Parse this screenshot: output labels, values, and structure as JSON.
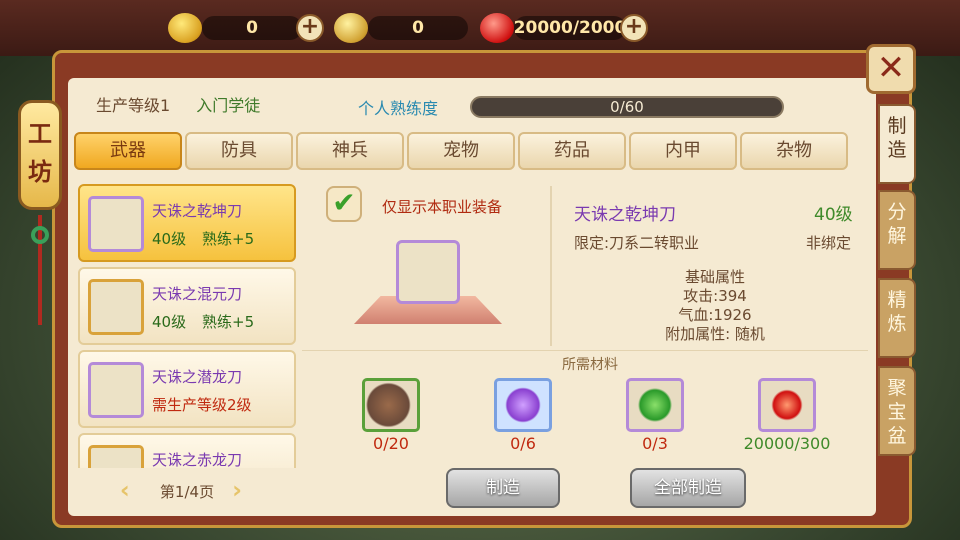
{
  "resources": [
    {
      "icon": "gold-ingot-icon",
      "value": "0"
    },
    {
      "icon": "locked-gold-ingot-icon",
      "value": "0"
    },
    {
      "icon": "red-gem-icon",
      "value": "20000/2000"
    }
  ],
  "plus_label": "+",
  "close_label": "✕",
  "workshop_label": "工坊",
  "side_tabs": [
    "制造",
    "分解",
    "精炼",
    "聚宝盆"
  ],
  "header": {
    "production_level": "生产等级1",
    "rank": "入门学徒",
    "proficiency_label": "个人熟练度",
    "proficiency_value": "0/60",
    "proficiency_fraction": 0
  },
  "categories": [
    "武器",
    "防具",
    "神兵",
    "宠物",
    "药品",
    "内甲",
    "杂物"
  ],
  "items": [
    {
      "name": "天诛之乾坤刀",
      "level": "40级",
      "proficiency": "熟练+5",
      "requirement": ""
    },
    {
      "name": "天诛之混元刀",
      "level": "40级",
      "proficiency": "熟练+5",
      "requirement": ""
    },
    {
      "name": "天诛之潜龙刀",
      "level": "",
      "proficiency": "",
      "requirement": "需生产等级2级"
    },
    {
      "name": "天诛之赤龙刀",
      "level": "",
      "proficiency": "",
      "requirement": ""
    }
  ],
  "pager": {
    "page": "第1/4页",
    "prev": "‹",
    "next": "›"
  },
  "filter": {
    "check": "✔",
    "label": "仅显示本职业装备"
  },
  "detail": {
    "name": "天诛之乾坤刀",
    "level": "40级",
    "restriction": "限定:刀系二转职业",
    "binding": "非绑定",
    "attr_title": "基础属性",
    "attack": "攻击:394",
    "hp": "气血:1926",
    "extra": "附加属性: 随机"
  },
  "materials_title": "所需材料",
  "materials": [
    {
      "icon": "stone-icon",
      "count": "0/20",
      "enough": false
    },
    {
      "icon": "purple-orb-icon",
      "count": "0/6",
      "enough": false
    },
    {
      "icon": "jade-icon",
      "count": "0/3",
      "enough": false
    },
    {
      "icon": "red-gem-icon",
      "count": "20000/300",
      "enough": true
    }
  ],
  "buttons": {
    "make": "制造",
    "make_all": "全部制造"
  }
}
